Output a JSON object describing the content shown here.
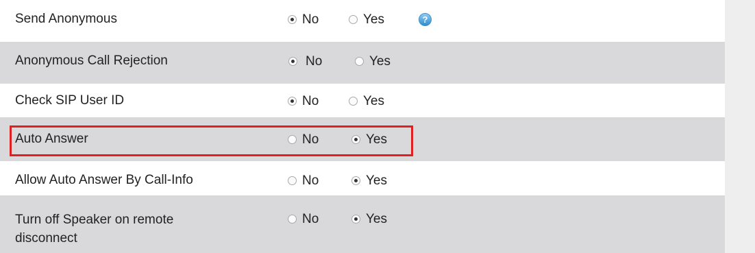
{
  "rows": [
    {
      "label": "Send Anonymous",
      "no": "No",
      "yes": "Yes",
      "selected": "no",
      "has_help": true,
      "help_icon": "help-icon"
    },
    {
      "label": "Anonymous Call Rejection",
      "no": "No",
      "yes": "Yes",
      "selected": "no"
    },
    {
      "label": "Check SIP User ID",
      "no": "No",
      "yes": "Yes",
      "selected": "no"
    },
    {
      "label": "Auto Answer",
      "no": "No",
      "yes": "Yes",
      "selected": "yes",
      "highlighted": true
    },
    {
      "label": "Allow Auto Answer By Call-Info",
      "no": "No",
      "yes": "Yes",
      "selected": "yes"
    },
    {
      "label": "Turn off Speaker on remote disconnect",
      "no": "No",
      "yes": "Yes",
      "selected": "yes"
    }
  ],
  "colors": {
    "highlight": "#e02020",
    "row_alt": "#d9d9dc",
    "row": "#ffffff"
  }
}
